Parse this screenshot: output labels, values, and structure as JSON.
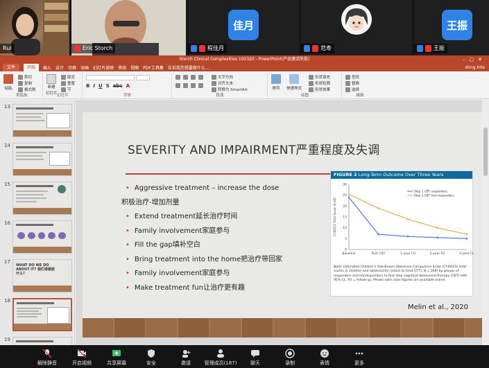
{
  "participants": [
    {
      "name": "Rui",
      "type": "video"
    },
    {
      "name": "Eric Storch",
      "type": "video"
    },
    {
      "name": "程佳月",
      "type": "avatar",
      "avatar_text": "佳月",
      "avatar_color": "#2f83e6"
    },
    {
      "name": "范寿",
      "type": "cartoon-avatar"
    },
    {
      "name": "王振",
      "type": "avatar",
      "avatar_text": "王振",
      "avatar_color": "#2f83e6"
    }
  ],
  "window": {
    "title": "Storch Clinical Complexities 102320 - PowerPoint(产品激活失败)"
  },
  "menu": {
    "file": "文件",
    "tabs": [
      "开始",
      "插入",
      "设计",
      "切换",
      "动画",
      "幻灯片放映",
      "审阅",
      "视图",
      "PDF工具集"
    ],
    "active": "开始",
    "search": "告诉我您想要做什么...",
    "user": "dong bite"
  },
  "ribbon": {
    "clipboard": {
      "paste": "粘贴",
      "cut": "剪切",
      "copy": "复制",
      "format": "格式刷",
      "label": "剪贴板"
    },
    "slides": {
      "new": "新建",
      "new2": "幻灯片",
      "layout": "版式",
      "reset": "重置",
      "section": "节",
      "label": "幻灯片"
    },
    "font_label": "字体",
    "paragraph": {
      "direction": "文字方向",
      "align": "对齐文本",
      "smartart": "转换为 SmartArt",
      "label": "段落"
    },
    "drawing": {
      "arrange": "排列",
      "styles": "快速样式",
      "fill": "形状填充",
      "outline": "形状轮廓",
      "effects": "形状效果",
      "label": "绘图"
    },
    "editing": {
      "find": "查找",
      "replace": "替换",
      "select": "选择",
      "label": "编辑"
    }
  },
  "thumbnails": [
    {
      "num": "13",
      "selected": false
    },
    {
      "num": "14",
      "selected": false
    },
    {
      "num": "15",
      "selected": false
    },
    {
      "num": "16",
      "selected": false
    },
    {
      "num": "17",
      "selected": false,
      "title": "WHAT DO WE DO ABOUT IT? 我们该做些什么？"
    },
    {
      "num": "18",
      "selected": true
    },
    {
      "num": "19",
      "selected": false
    }
  ],
  "slide": {
    "title": "SEVERITY AND IMPAIRMENT严重程度及失调",
    "bullets": [
      {
        "text": "Aggressive treatment – increase the dose",
        "dot": true
      },
      {
        "text": "积极治疗-增加剂量",
        "dot": false
      },
      {
        "text": "Extend treatment延长治疗时间",
        "dot": true
      },
      {
        "text": "Family involvement家庭参与",
        "dot": true
      },
      {
        "text": "Fill the gap填补空白",
        "dot": true
      },
      {
        "text": "Bring treatment into the home把治疗带回家",
        "dot": true
      },
      {
        "text": "Family involvement家庭参与",
        "dot": true
      },
      {
        "text": "Make treatment fun让治疗更有趣",
        "dot": true
      }
    ],
    "citation": "Melin et al., 2020",
    "figure": {
      "label": "FIGURE 2",
      "title": "Long-Term Outcome Over Three Years",
      "note": "Note: Estimated Children's Yale-Brown Obsessive-Compulsive Scale (CY-BOCS) total scores in children and adolescents (intent to treat [ITT]; N = 269) by groups of responders and nonresponders to first step cognitive-behavioral therapy (CBT) with 95% CL. FU = follow-up. Please note color figures are available online."
    }
  },
  "chart_data": {
    "type": "line",
    "categories": [
      "Baseline",
      "Post CBT",
      "1-year FU",
      "2-year FU",
      "3-year FU"
    ],
    "ylabel": "CY-BOCS Total Score (0-40)",
    "ylim": [
      0,
      30
    ],
    "yticks": [
      0,
      5,
      10,
      15,
      20,
      25,
      30
    ],
    "series": [
      {
        "name": "Step 1 CBT responders",
        "color": "#4a6fd1",
        "values": [
          24,
          7,
          6,
          5.5,
          5
        ]
      },
      {
        "name": "Step 1 CBT non-responders",
        "color": "#e3a54a",
        "values": [
          25.5,
          19,
          14,
          10,
          7
        ]
      }
    ]
  },
  "toolbar": [
    {
      "label": "解除静音",
      "icon": "mic-muted-icon",
      "color": "#e04141"
    },
    {
      "label": "开启视频",
      "icon": "video-off-icon",
      "color": "#e04141"
    },
    {
      "label": "共享屏幕",
      "icon": "share-screen-icon",
      "color": "#34c16b"
    },
    {
      "label": "安全",
      "icon": "shield-icon",
      "color": "#e6e6e6"
    },
    {
      "label": "邀请",
      "icon": "invite-icon",
      "color": "#e6e6e6"
    },
    {
      "label": "管理成员(187)",
      "icon": "members-icon",
      "color": "#e6e6e6"
    },
    {
      "label": "聊天",
      "icon": "chat-icon",
      "color": "#e6e6e6"
    },
    {
      "label": "录制",
      "icon": "record-icon",
      "color": "#e6e6e6"
    },
    {
      "label": "表情",
      "icon": "emoji-icon",
      "color": "#e6e6e6"
    },
    {
      "label": "更多",
      "icon": "more-icon",
      "color": "#e6e6e6"
    }
  ]
}
